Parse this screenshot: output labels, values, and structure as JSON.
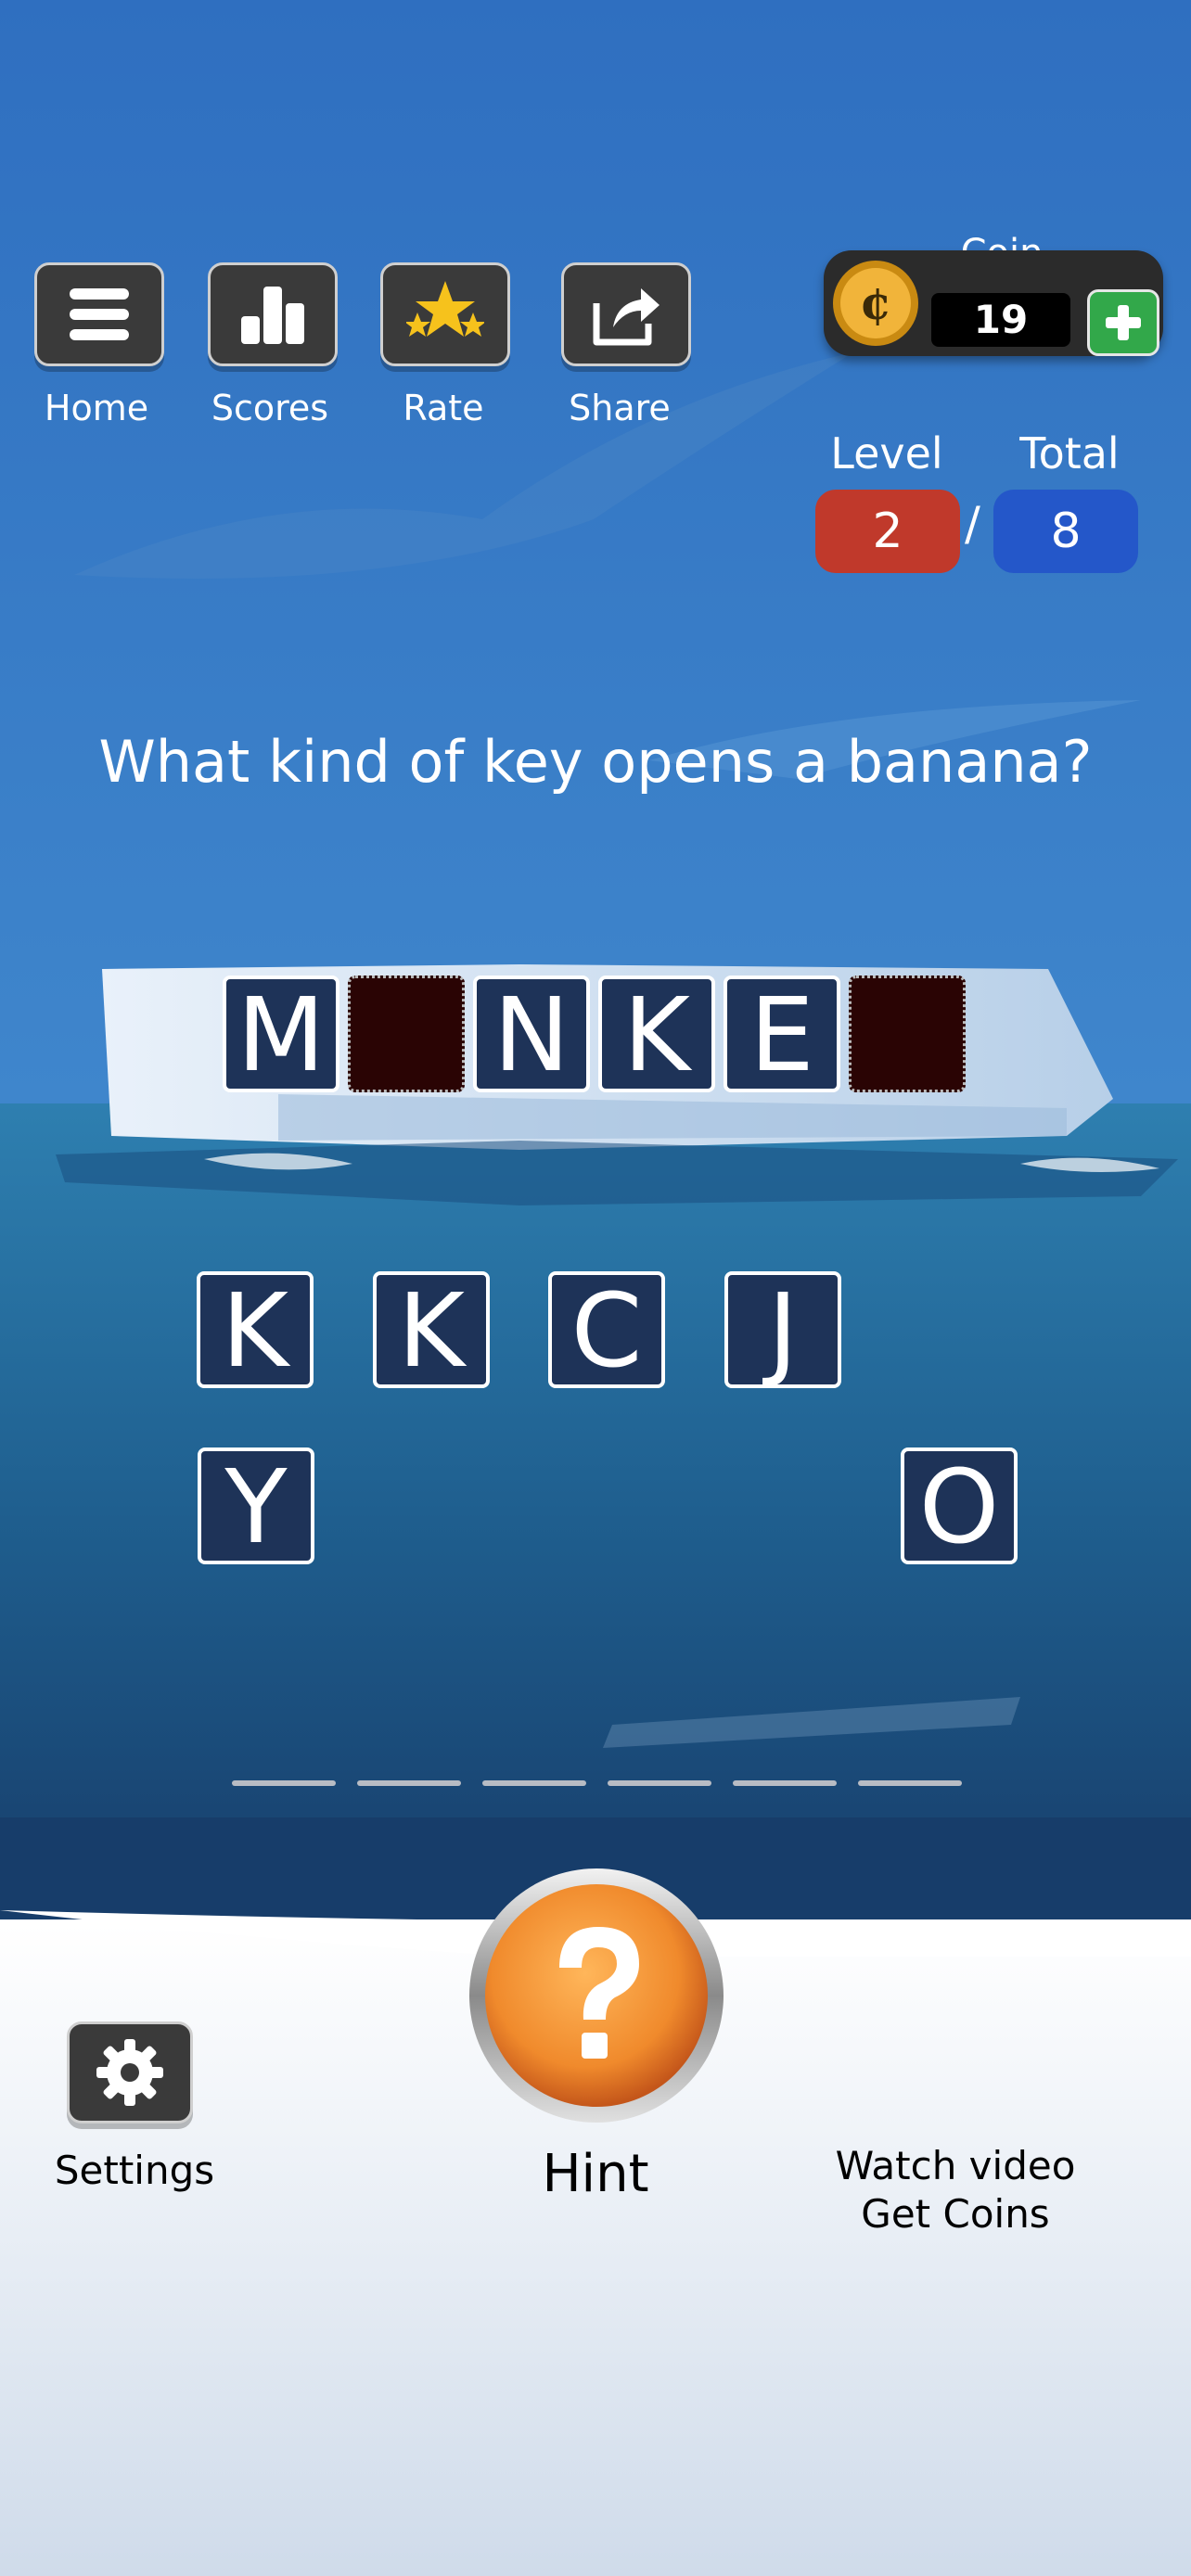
{
  "toolbar": {
    "home_label": "Home",
    "scores_label": "Scores",
    "rate_label": "Rate",
    "share_label": "Share"
  },
  "coin": {
    "label": "Coin",
    "value": "19"
  },
  "progress": {
    "level_label": "Level",
    "total_label": "Total",
    "level": "2",
    "separator": "/",
    "total": "8"
  },
  "question": "What kind of key opens a banana?",
  "answer_slots": [
    "M",
    "",
    "N",
    "K",
    "E",
    ""
  ],
  "letter_choices": [
    "K",
    "K",
    "C",
    "J",
    "Y",
    "O"
  ],
  "bottom": {
    "settings_label": "Settings",
    "hint_label": "Hint",
    "watch_line1": "Watch video",
    "watch_line2": "Get Coins"
  },
  "colors": {
    "level_pill": "#c0392b",
    "total_pill": "#2457c9",
    "tile_bg": "#1e3358",
    "empty_slot": "#2a0404",
    "hint_button": "#f08a2c"
  },
  "icons": {
    "home": "menu-icon",
    "scores": "bar-chart-icon",
    "rate": "stars-icon",
    "share": "share-icon",
    "settings": "gear-icon",
    "hint": "question-mark-icon",
    "coin": "coin-icon",
    "add": "plus-icon"
  }
}
